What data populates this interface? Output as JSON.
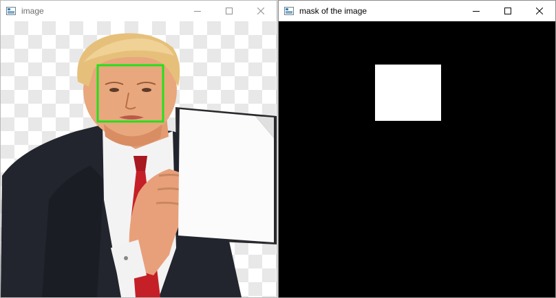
{
  "windows": {
    "image": {
      "title": "image",
      "icon": "opencv-window-icon",
      "controls": {
        "minimize": "minimize-icon",
        "maximize": "maximize-icon",
        "close": "close-icon"
      }
    },
    "mask": {
      "title": "mask of the image",
      "icon": "opencv-window-icon",
      "controls": {
        "minimize": "minimize-icon",
        "maximize": "maximize-icon",
        "close": "close-icon"
      }
    }
  },
  "colors": {
    "detection_box": "#22e01a",
    "mask_background": "#000000",
    "mask_region": "#ffffff"
  }
}
